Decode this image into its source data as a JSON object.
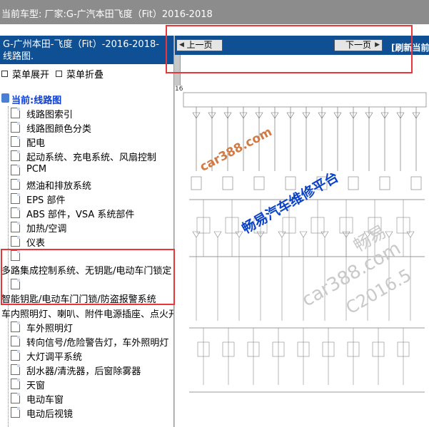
{
  "header": {
    "title": "当前车型:  厂家:G-广汽本田飞度（Fit）2016-2018"
  },
  "sidebar": {
    "title": "G-广州本田-飞度（Fit）-2016-2018- 线路图.",
    "expand_label": "菜单展开",
    "collapse_label": "菜单折叠",
    "root_label": "当前:线路图",
    "items": [
      {
        "label": "线路图索引"
      },
      {
        "label": "线路图颜色分类"
      },
      {
        "label": "配电"
      },
      {
        "label": "起动系统、充电系统、风扇控制"
      },
      {
        "label": "PCM"
      },
      {
        "label": "燃油和排放系统"
      },
      {
        "label": "EPS 部件"
      },
      {
        "label": "ABS 部件，VSA 系统部件"
      },
      {
        "label": "加热/空调"
      },
      {
        "label": "仪表"
      },
      {
        "label": "多路集成控制系统、无钥匙/电动车门锁定"
      },
      {
        "label": "智能钥匙/电动车门门锁/防盗报警系统"
      },
      {
        "label": "车内照明灯、喇叭、附件电源插座、点火开"
      },
      {
        "label": "车外照明灯"
      },
      {
        "label": "转向信号/危险警告灯，车外照明灯"
      },
      {
        "label": "大灯调平系统"
      },
      {
        "label": "刮水器/清洗器，后窗除雾器"
      },
      {
        "label": "天窗"
      },
      {
        "label": "电动车窗"
      },
      {
        "label": "电动后视镜"
      }
    ]
  },
  "nav": {
    "prev_label": "上一页",
    "next_label": "下一页",
    "refresh_label": "[刷新当前"
  },
  "diagram": {
    "page_number": "16",
    "watermark_1": "car388.com",
    "watermark_2": "畅易汽车维修平台",
    "watermark_3": "畅易",
    "watermark_4": "car388.com",
    "watermark_5": "C2016.5"
  },
  "colors": {
    "topbar": "#8c8c8c",
    "panel_blue": "#0f4f93",
    "highlight_red": "#e8363a",
    "root_link": "#0a3dd6"
  }
}
